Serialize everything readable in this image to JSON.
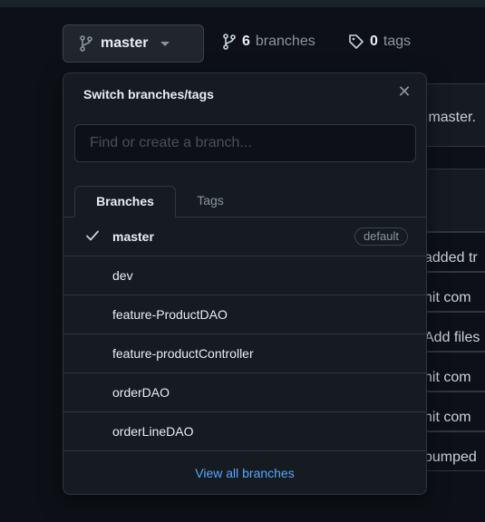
{
  "branch_selector": {
    "current_branch": "master"
  },
  "repo_meta": {
    "branches_count": "6",
    "branches_label": "branches",
    "tags_count": "0",
    "tags_label": "tags"
  },
  "background": {
    "peek_texts": [
      ":master.",
      "added tr",
      "nit com",
      "Add files",
      "nit com",
      "nit com",
      "bumped"
    ]
  },
  "dropdown": {
    "title": "Switch branches/tags",
    "search_placeholder": "Find or create a branch...",
    "tabs": [
      {
        "label": "Branches",
        "active": true
      },
      {
        "label": "Tags",
        "active": false
      }
    ],
    "branches": [
      {
        "name": "master",
        "selected": true,
        "badge": "default"
      },
      {
        "name": "dev"
      },
      {
        "name": "feature-ProductDAO"
      },
      {
        "name": "feature-productController"
      },
      {
        "name": "orderDAO"
      },
      {
        "name": "orderLineDAO"
      }
    ],
    "footer_link": "View all branches"
  }
}
